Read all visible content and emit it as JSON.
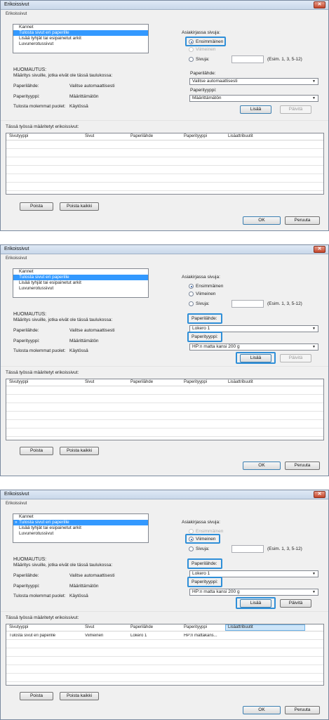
{
  "windows": [
    {
      "title": "Erikoissivut",
      "group_label": "Erikoissivut",
      "page_list": {
        "items": [
          "Kannet",
          "Tulosta sivut eri paperille",
          "Lisää tyhjät tai esipainetut arkit",
          "Luvunerotussivut"
        ],
        "selected": 1,
        "marker": ""
      },
      "print_pages_label": "Asiakirjassa sivuja:",
      "radio_options": [
        "Ensimmäinen",
        "Viimeinen",
        "Sivuja:"
      ],
      "radio_selected": 0,
      "radio_first_blurred": "Ensimmäinen",
      "pages_example": "(Esim. 1, 3, 5-12)",
      "note_title": "HUOMAUTUS:",
      "note_text": "Määritys sivuille, jotka eivät ole tässä taulukossa:",
      "note_rows": [
        {
          "label": "Paperilähde:",
          "value": "Valitse automaattisesti"
        },
        {
          "label": "Paperityyppi:",
          "value": "Määrittämätön"
        },
        {
          "label": "Tulosta molemmat puolet:",
          "value": "Käytössä"
        }
      ],
      "source_label": "Paperilähde:",
      "source_value": "Valitse automaattisesti",
      "type_label": "Paperityyppi:",
      "type_value": "Määrittämätön",
      "add_label": "Lisää",
      "update_label": "Päivitä",
      "table_title": "Tässä työssä määritetyt erikoissivut:",
      "columns": [
        "Sivutyyppi",
        "Sivut",
        "Paperilähde",
        "Paperityyppi",
        "Lisäattribuutit"
      ],
      "rows": [],
      "delete_label": "Poista",
      "delete_all_label": "Poista kaikki",
      "ok_label": "OK",
      "cancel_label": "Peruuta"
    },
    {
      "title": "Erikoissivut",
      "group_label": "Erikoissivut",
      "page_list": {
        "items": [
          "Kannet",
          "Tulosta sivut eri paperille",
          "Lisää tyhjät tai esipainetut arkit",
          "Luvunerotussivut"
        ],
        "selected": 1,
        "marker": ""
      },
      "print_pages_label": "Asiakirjassa sivuja:",
      "radio_options": [
        "Ensimmäinen",
        "Viimeinen",
        "Sivuja:"
      ],
      "radio_selected": 0,
      "pages_example": "(Esim. 1, 3, 5-12)",
      "note_title": "HUOMAUTUS:",
      "note_text": "Määritys sivuille, jotka eivät ole tässä taulukossa:",
      "note_rows": [
        {
          "label": "Paperilähde:",
          "value": "Valitse automaattisesti"
        },
        {
          "label": "Paperityyppi:",
          "value": "Määrittämätön"
        },
        {
          "label": "Tulosta molemmat puolet:",
          "value": "Käytössä"
        }
      ],
      "source_label": "Paperilähde:",
      "source_value": "Lokero 1",
      "type_label": "Paperityyppi:",
      "type_value": "HP:n matta kansi 200 g",
      "add_label": "Lisää",
      "update_label": "Päivitä",
      "table_title": "Tässä työssä määritetyt erikoissivut:",
      "columns": [
        "Sivutyyppi",
        "Sivut",
        "Paperilähde",
        "Paperityyppi",
        "Lisäattribuutit"
      ],
      "rows": [],
      "delete_label": "Poista",
      "delete_all_label": "Poista kaikki",
      "ok_label": "OK",
      "cancel_label": "Peruuta"
    },
    {
      "title": "Erikoissivut",
      "group_label": "Erikoissivut",
      "page_list": {
        "items": [
          "Kannet",
          "Tulosta sivut eri paperille",
          "Lisää tyhjät tai esipainetut arkit",
          "Luvunerotussivut"
        ],
        "selected": 1,
        "marker": "»"
      },
      "print_pages_label": "Asiakirjassa sivuja:",
      "radio_options": [
        "Ensimmäinen",
        "Viimeinen",
        "Sivuja:"
      ],
      "radio_selected": 1,
      "pages_example": "(Esim. 1, 3, 5-12)",
      "note_title": "HUOMAUTUS:",
      "note_text": "Määritys sivuille, jotka eivät ole tässä taulukossa:",
      "note_rows": [
        {
          "label": "Paperilähde:",
          "value": "Valitse automaattisesti"
        },
        {
          "label": "Paperityyppi:",
          "value": "Määrittämätön"
        },
        {
          "label": "Tulosta molemmat puolet:",
          "value": "Käytössä"
        }
      ],
      "source_label": "Paperilähde:",
      "source_value": "Lokero 1",
      "type_label": "Paperityyppi:",
      "type_value": "HP:n matta kansi 200 g",
      "add_label": "Lisää",
      "update_label": "Päivitä",
      "table_title": "Tässä työssä määritetyt erikoissivut:",
      "columns": [
        "Sivutyyppi",
        "Sivut",
        "Paperilähde",
        "Paperityyppi",
        "Lisäattribuutit"
      ],
      "rows": [
        [
          "Tulosta sivut eri paperille",
          "Viimeinen",
          "Lokero 1",
          "HP:n mattakans...",
          ""
        ]
      ],
      "delete_label": "Poista",
      "delete_all_label": "Poista kaikki",
      "ok_label": "OK",
      "cancel_label": "Peruuta"
    }
  ],
  "colors": {
    "selection": "#3399ff",
    "highlight_callout": "#2f8fd8",
    "close_button": "#c4452a"
  }
}
